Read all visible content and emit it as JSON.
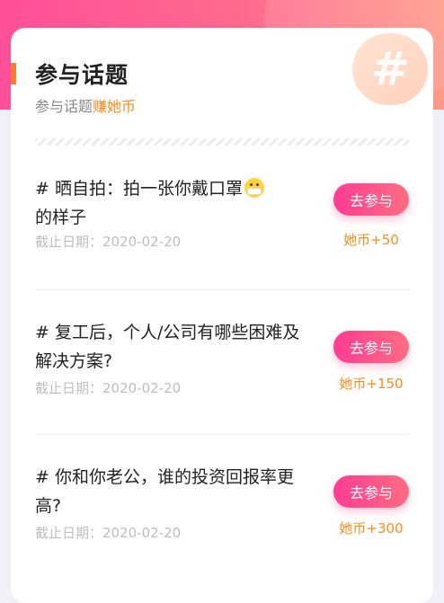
{
  "header": {
    "title": "参与话题",
    "subtitle_prefix": "参与话题",
    "subtitle_highlight": "赚她币",
    "badge_symbol": "#"
  },
  "topics": [
    {
      "question": "# 晒自拍：拍一张你戴口罩",
      "question_tail": "的样子",
      "icon": "face-mask-emoji",
      "deadline": "截止日期：2020-02-20",
      "button": "去参与",
      "reward": "她币+50"
    },
    {
      "question": "# 复工后，个人/公司有哪些困难及解决方案?",
      "deadline": "截止日期：2020-02-20",
      "button": "去参与",
      "reward": "她币+150"
    },
    {
      "question": "# 你和你老公，谁的投资回报率更高?",
      "deadline": "截止日期：2020-02-20",
      "button": "去参与",
      "reward": "她币+300"
    }
  ],
  "colors": {
    "accent_pink": "#ff3c93",
    "accent_orange": "#ff8a1c",
    "header_gradient_start": "#ff4f98",
    "header_gradient_end": "#ff9a8a"
  }
}
